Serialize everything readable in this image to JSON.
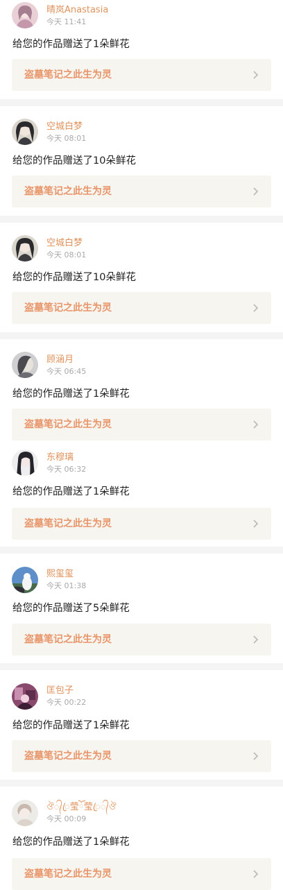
{
  "theme": {
    "username_color": "#e0925c",
    "work_title_color": "#e8956a",
    "chevron_color": "#b9b9b9"
  },
  "notifications": [
    {
      "user": "晴岚Anastasia",
      "time": "今天 11:41",
      "message": "给您的作品赠送了1朵鲜花",
      "work_title": "盗墓笔记之此生为灵",
      "avatar_icon": "avatar-girl-pink-icon"
    },
    {
      "user": "空城白梦",
      "time": "今天 08:01",
      "message": "给您的作品赠送了10朵鲜花",
      "work_title": "盗墓笔记之此生为灵",
      "avatar_icon": "avatar-anime-dark-hair-icon"
    },
    {
      "user": "空城白梦",
      "time": "今天 08:01",
      "message": "给您的作品赠送了10朵鲜花",
      "work_title": "盗墓笔记之此生为灵",
      "avatar_icon": "avatar-anime-dark-hair-icon"
    },
    {
      "user": "顾涵月",
      "time": "今天 06:45",
      "message": "给您的作品赠送了1朵鲜花",
      "work_title": "盗墓笔记之此生为灵",
      "avatar_icon": "avatar-gray-portrait-icon"
    },
    {
      "user": "东穆璃",
      "time": "今天 06:32",
      "message": "给您的作品赠送了1朵鲜花",
      "work_title": "盗墓笔记之此生为灵",
      "avatar_icon": "avatar-long-hair-icon"
    },
    {
      "user": "熙玺玺",
      "time": "今天 01:38",
      "message": "给您的作品赠送了5朵鲜花",
      "work_title": "盗墓笔记之此生为灵",
      "avatar_icon": "avatar-blue-sky-icon"
    },
    {
      "user": "匡包子",
      "time": "今天 00:22",
      "message": "给您的作品赠送了1朵鲜花",
      "work_title": "盗墓笔记之此生为灵",
      "avatar_icon": "avatar-purple-scene-icon"
    },
    {
      "user": "ঔ᭄ꦿ莹ོ莹ꦿ᭄ঔ",
      "time": "今天 00:09",
      "message": "给您的作品赠送了1朵鲜花",
      "work_title": "盗墓笔记之此生为灵",
      "avatar_icon": "avatar-pale-portrait-icon"
    }
  ]
}
